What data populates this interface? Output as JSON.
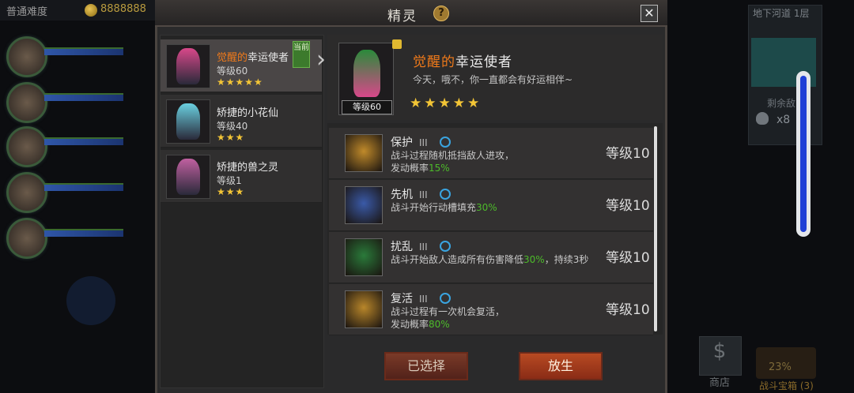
{
  "hud": {
    "difficulty": "普通难度",
    "coins": "8888888",
    "floor": "地下河道 1层",
    "remaining_label": "剩余敌",
    "remaining_value": "x8",
    "shop_label": "商店",
    "chest_percent": "23%",
    "chest_label": "战斗宝箱 (3)"
  },
  "modal": {
    "title": "精灵",
    "help": "?",
    "close": "✕"
  },
  "sprites": [
    {
      "name_prefix": "觉醒的",
      "name_rest": "幸运使者",
      "level": "等级60",
      "stars": "★★★★★",
      "color": "#d8488a"
    },
    {
      "name_prefix": "",
      "name_rest": "矫捷的小花仙",
      "level": "等级40",
      "stars": "★★★",
      "color": "#6ad0e0"
    },
    {
      "name_prefix": "",
      "name_rest": "矫捷的兽之灵",
      "level": "等级1",
      "stars": "★★★",
      "color": "#c060a0"
    }
  ],
  "current_tag": "当前",
  "detail": {
    "name_prefix": "觉醒的",
    "name_rest": "幸运使者",
    "desc": "今天，哦不，你一直都会有好运相伴~",
    "level_badge": "等级60",
    "stars": "★★★★★"
  },
  "skills": [
    {
      "name": "保护",
      "tier": "III",
      "desc_a": "战斗过程随机抵挡敌人进攻，",
      "desc_b": "发动概率",
      "pct": "15%",
      "desc_c": "",
      "level": "等级10",
      "color": "#c08a2a"
    },
    {
      "name": "先机",
      "tier": "III",
      "desc_a": "战斗开始行动槽填充",
      "desc_b": "",
      "pct": "30%",
      "desc_c": "",
      "level": "等级10",
      "color": "#3a5aa8"
    },
    {
      "name": "扰乱",
      "tier": "III",
      "desc_a": "战斗开始敌人造成所有伤害降低",
      "desc_b": "",
      "pct": "30%",
      "desc_c": "，持续3秒",
      "level": "等级10",
      "color": "#2a7a3a"
    },
    {
      "name": "复活",
      "tier": "III",
      "desc_a": "战斗过程有一次机会复活，",
      "desc_b": "发动概率",
      "pct": "80%",
      "desc_c": "",
      "level": "等级10",
      "color": "#b8862a"
    }
  ],
  "buttons": {
    "chosen": "已选择",
    "release": "放生"
  }
}
